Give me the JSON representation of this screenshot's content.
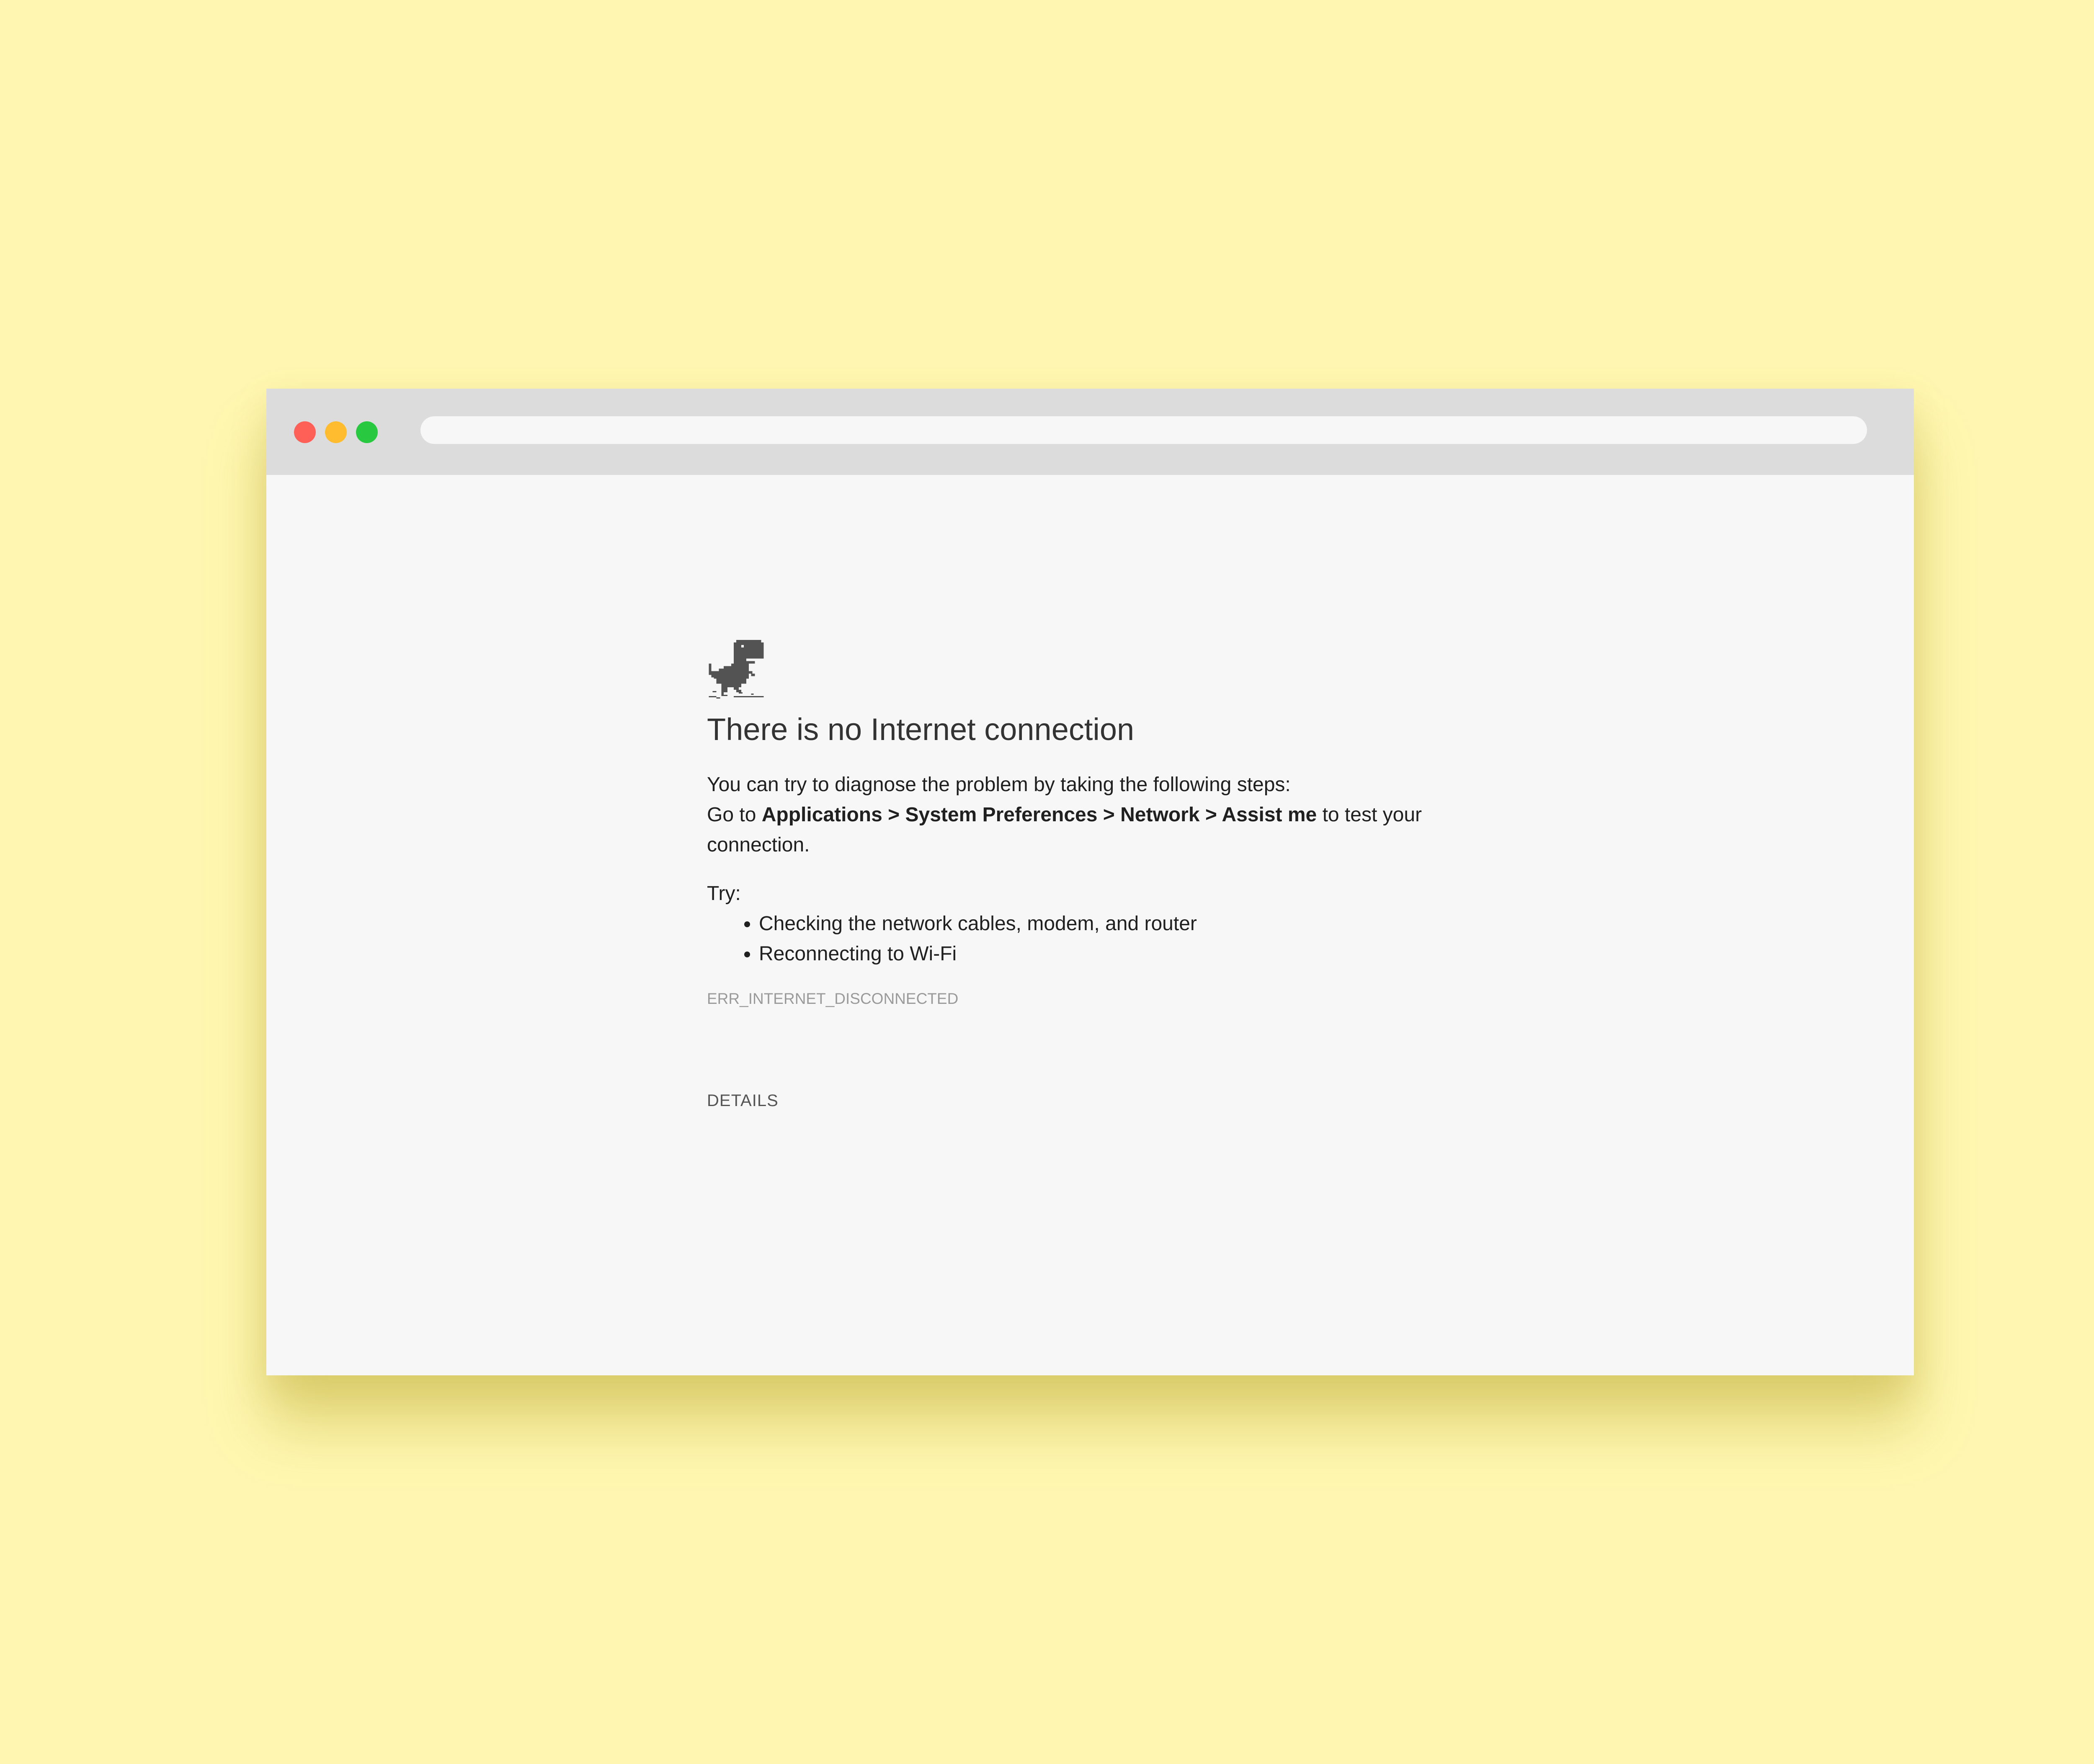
{
  "colors": {
    "background": "#fff7b1",
    "window": "#f7f7f7",
    "titlebar": "#dcdcdc",
    "close": "#fe5f57",
    "minimize": "#febc2e",
    "maximize": "#28c840",
    "text": "#333333",
    "error_code": "#9a9a9a"
  },
  "icons": {
    "dino": "offline-dino-icon"
  },
  "error_page": {
    "heading": "There is no Internet connection",
    "intro": "You can try to diagnose the problem by taking the following steps:",
    "goto_prefix": "Go to",
    "goto_path": "Applications > System Preferences > Network > Assist me",
    "goto_suffix": "to test your connection.",
    "try_label": "Try:",
    "suggestions": [
      "Checking the network cables, modem, and router",
      "Reconnecting to Wi-Fi"
    ],
    "error_code": "ERR_INTERNET_DISCONNECTED",
    "details_label": "DETAILS"
  }
}
